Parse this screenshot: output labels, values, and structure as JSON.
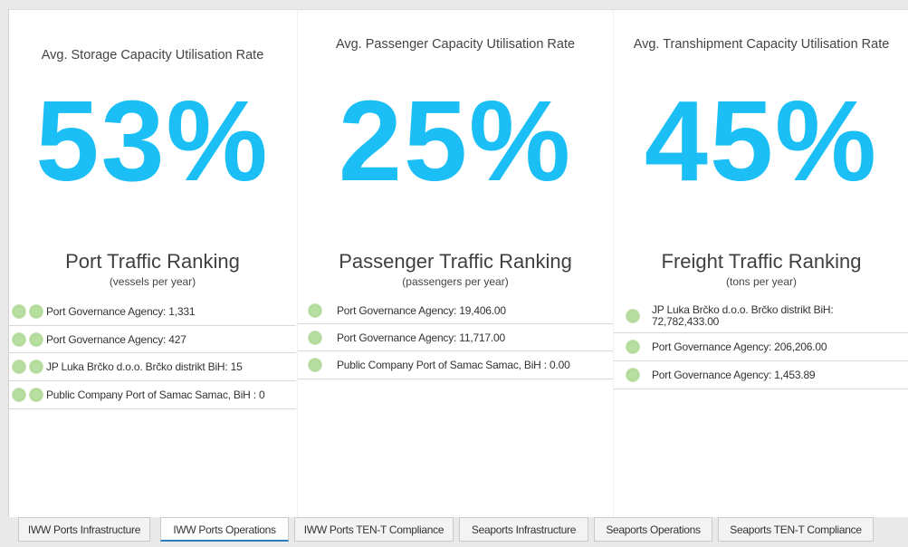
{
  "kpis": [
    {
      "title": "Avg. Storage Capacity Utilisation Rate",
      "value": "53%"
    },
    {
      "title": "Avg. Passenger Capacity Utilisation Rate",
      "value": "25%"
    },
    {
      "title": "Avg. Transhipment Capacity Utilisation Rate",
      "value": "45%"
    }
  ],
  "rankings": [
    {
      "title": "Port Traffic Ranking",
      "subtitle": "(vessels per year)",
      "items": [
        "Port Governance Agency: 1,331",
        "Port Governance Agency: 427",
        "JP Luka Brčko d.o.o. Brčko distrikt BiH: 15",
        "Public Company Port of Samac Samac, BiH : 0"
      ]
    },
    {
      "title": "Passenger Traffic Ranking",
      "subtitle": "(passengers per year)",
      "items": [
        "Port Governance Agency: 19,406.00",
        "Port Governance Agency: 11,717.00",
        "Public Company Port of Samac Samac, BiH : 0.00"
      ]
    },
    {
      "title": "Freight Traffic Ranking",
      "subtitle": "(tons per year)",
      "items": [
        "JP Luka Brčko d.o.o. Brčko distrikt BiH: 72,782,433.00",
        "Port Governance Agency: 206,206.00",
        "Port Governance Agency: 1,453.89"
      ]
    }
  ],
  "tabs": [
    {
      "label": "IWW Ports Infrastructure"
    },
    {
      "label": "IWW Ports Operations",
      "active": true
    },
    {
      "label": "IWW Ports TEN-T Compliance"
    },
    {
      "label": "Seaports Infrastructure"
    },
    {
      "label": "Seaports Operations"
    },
    {
      "label": "Seaports TEN-T Compliance"
    }
  ],
  "colors": {
    "kpi": "#1bbff5",
    "tab_active_underline": "#2b7bbf"
  }
}
